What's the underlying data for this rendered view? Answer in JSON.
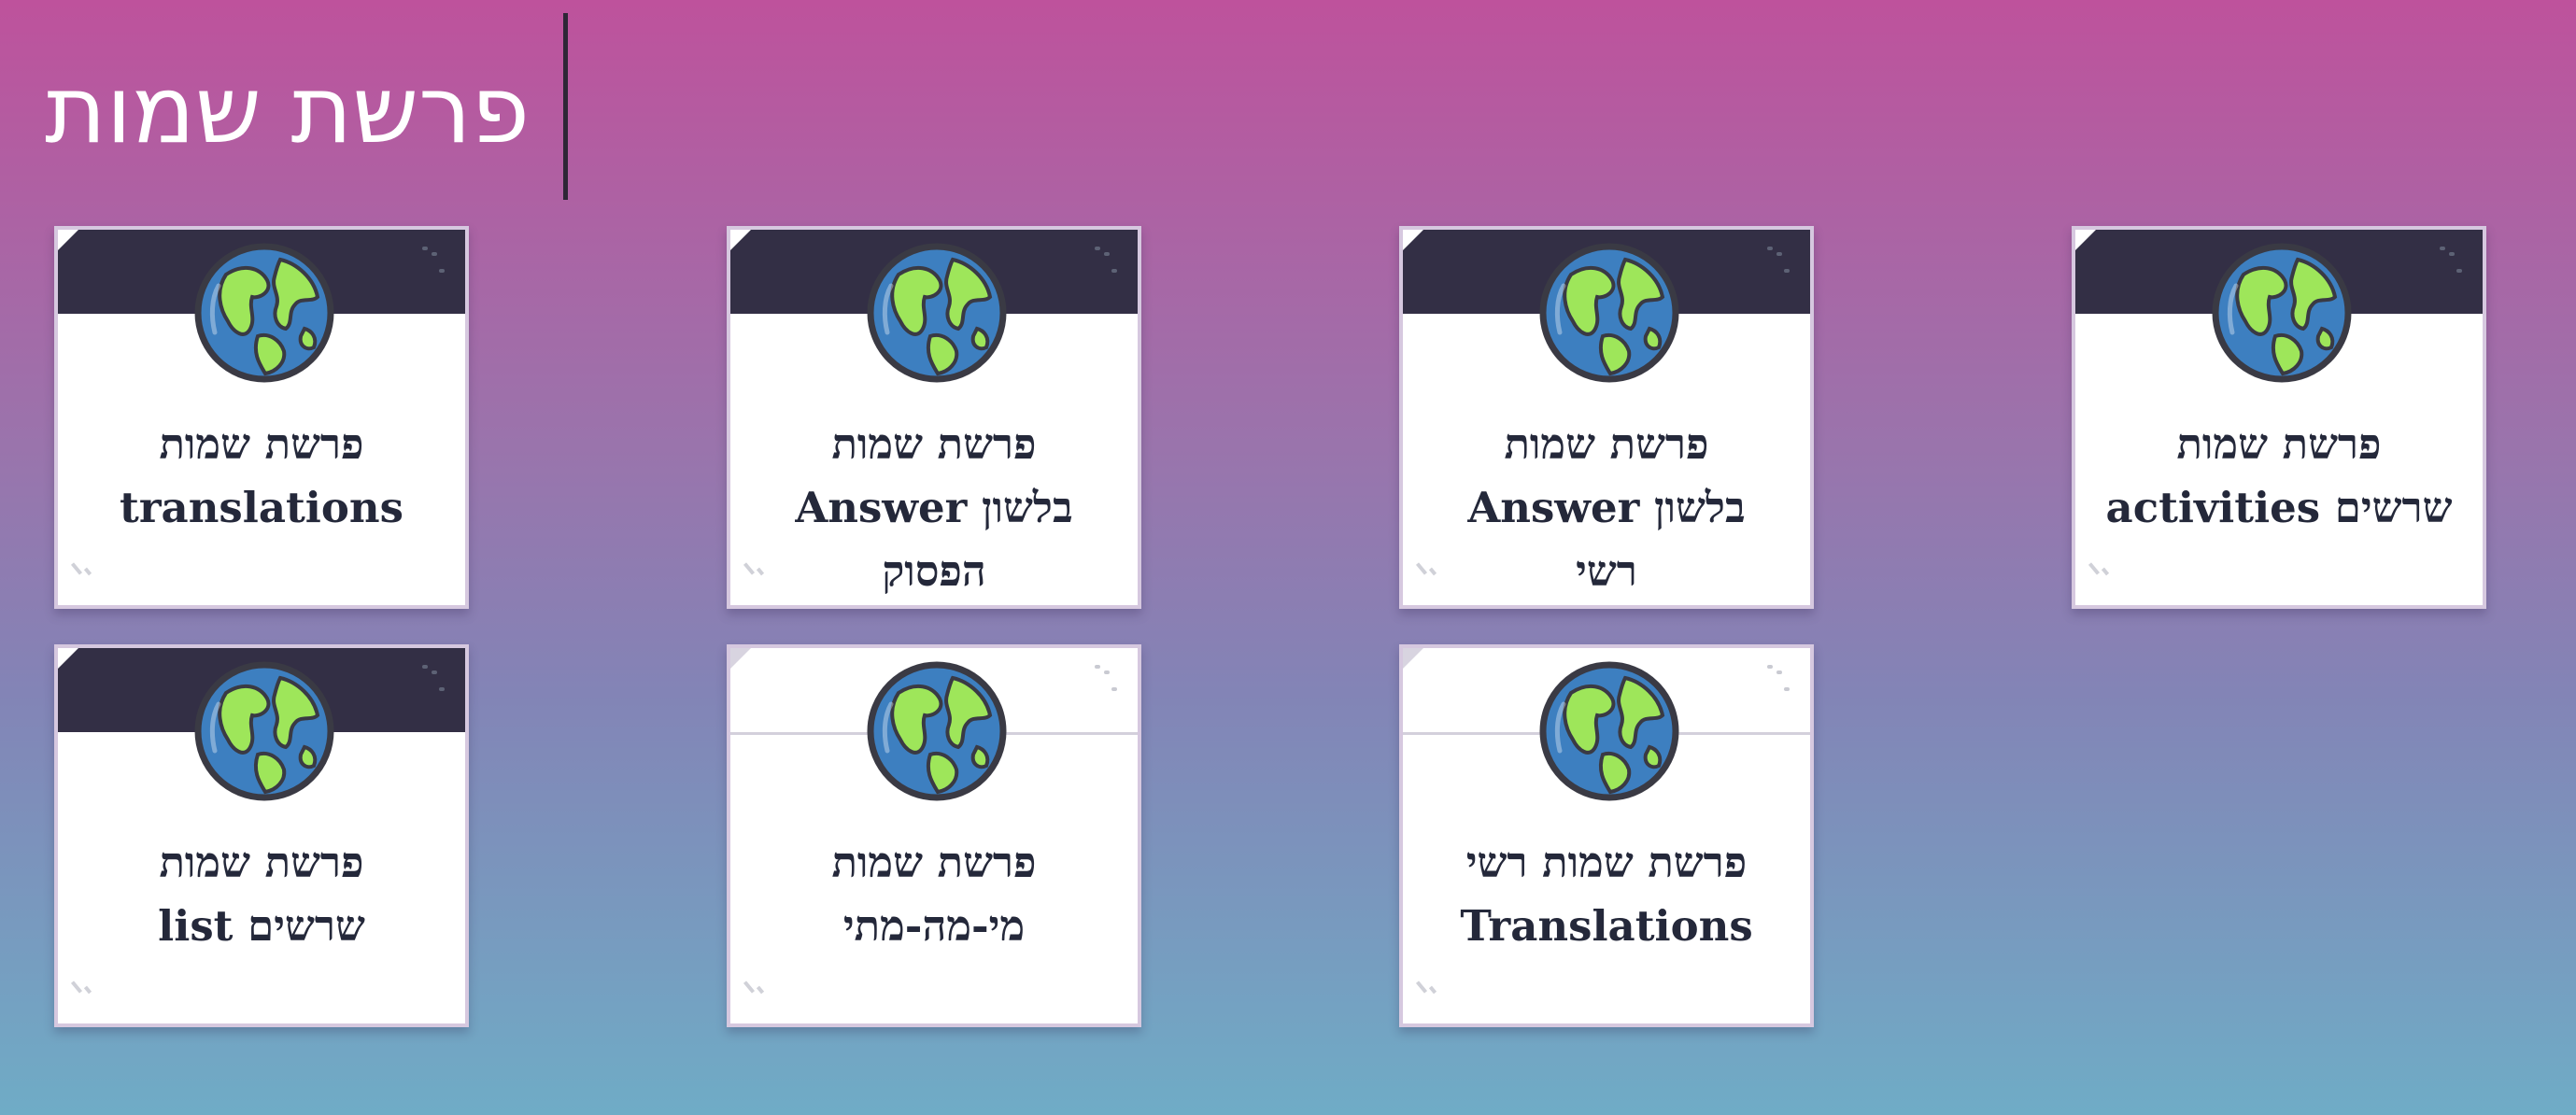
{
  "page": {
    "title": "פרשת שמות"
  },
  "colors": {
    "card_band_dark": "#332f45",
    "globe_ocean": "#3d7fc0",
    "globe_land": "#9ee65a",
    "card_text": "#24283a"
  },
  "cards": [
    {
      "icon": "globe-icon",
      "line1": "פרשת שמות",
      "line2": "translations",
      "line3": ""
    },
    {
      "icon": "globe-icon",
      "line1": "פרשת שמות",
      "line2": "בלשון Answer",
      "line3": "הפסוק"
    },
    {
      "icon": "globe-icon",
      "line1": "פרשת שמות",
      "line2": "בלשון Answer",
      "line3": "רשי"
    },
    {
      "icon": "globe-icon",
      "line1": "פרשת שמות",
      "line2": "שרשים activities",
      "line3": ""
    },
    {
      "icon": "globe-icon",
      "line1": "פרשת שמות",
      "line2": "שרשים list",
      "line3": ""
    },
    {
      "icon": "globe-icon",
      "line1": "פרשת שמות",
      "line2": "מי-מה-מתי",
      "line3": ""
    },
    {
      "icon": "globe-icon",
      "line1": "פרשת שמות רשי",
      "line2": "Translations",
      "line3": ""
    }
  ]
}
